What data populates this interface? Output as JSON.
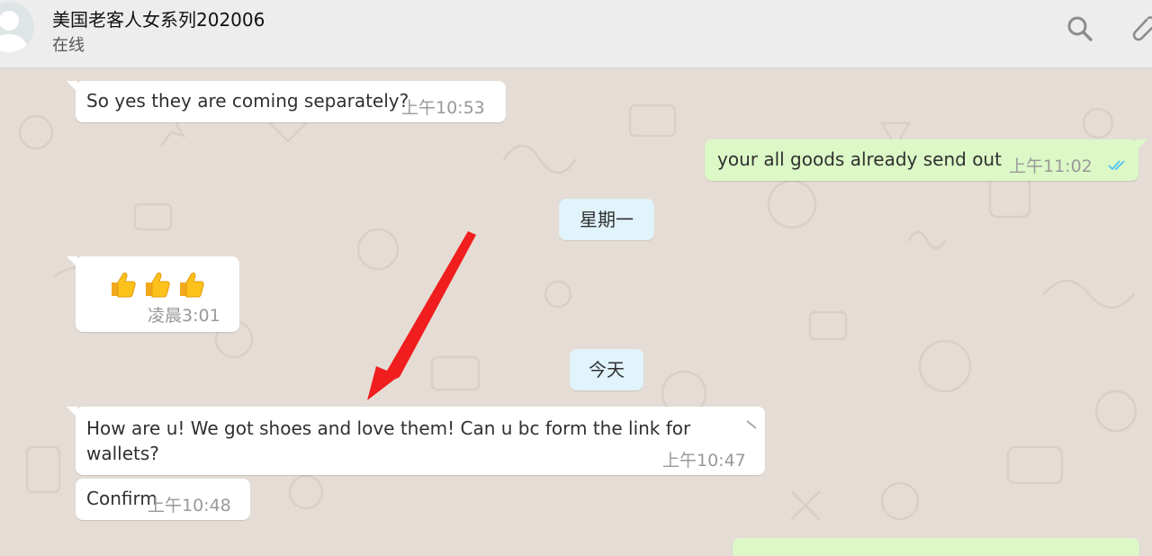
{
  "header": {
    "contact_name": "美国老客人女系列202006",
    "status": "在线"
  },
  "messages": [
    {
      "id": "m1",
      "direction": "incoming",
      "text": "So yes they are coming separately?",
      "time": "上午10:53"
    },
    {
      "id": "m2",
      "direction": "outgoing",
      "text": "your all goods already send out",
      "time": "上午11:02",
      "read": true
    },
    {
      "id": "d1",
      "type": "date",
      "label": "星期一"
    },
    {
      "id": "m3",
      "direction": "incoming",
      "emoji": [
        "thumbs-up",
        "thumbs-up",
        "thumbs-up"
      ],
      "time": "凌晨3:01"
    },
    {
      "id": "d2",
      "type": "date",
      "label": "今天"
    },
    {
      "id": "m4",
      "direction": "incoming",
      "lines": [
        "How are u! We got shoes and love them! Can u bc form the link for",
        "wallets?"
      ],
      "time": "上午10:47"
    },
    {
      "id": "m5",
      "direction": "incoming",
      "text": "Confirm",
      "time": "上午10:48"
    },
    {
      "id": "m6",
      "direction": "outgoing",
      "text": "",
      "partial": true
    }
  ],
  "icons": {
    "search": "search-icon",
    "attach": "paperclip-icon",
    "avatar": "default-avatar-icon",
    "read_receipt": "double-check-icon",
    "annotation": "red-arrow"
  },
  "colors": {
    "header_bg": "#ededed",
    "chat_bg": "#e5ddd5",
    "incoming_bubble": "#ffffff",
    "outgoing_bubble": "#dcf8c6",
    "date_chip": "#e1f3fb",
    "read_tick": "#4fc3f7",
    "arrow": "#f01e1e"
  }
}
